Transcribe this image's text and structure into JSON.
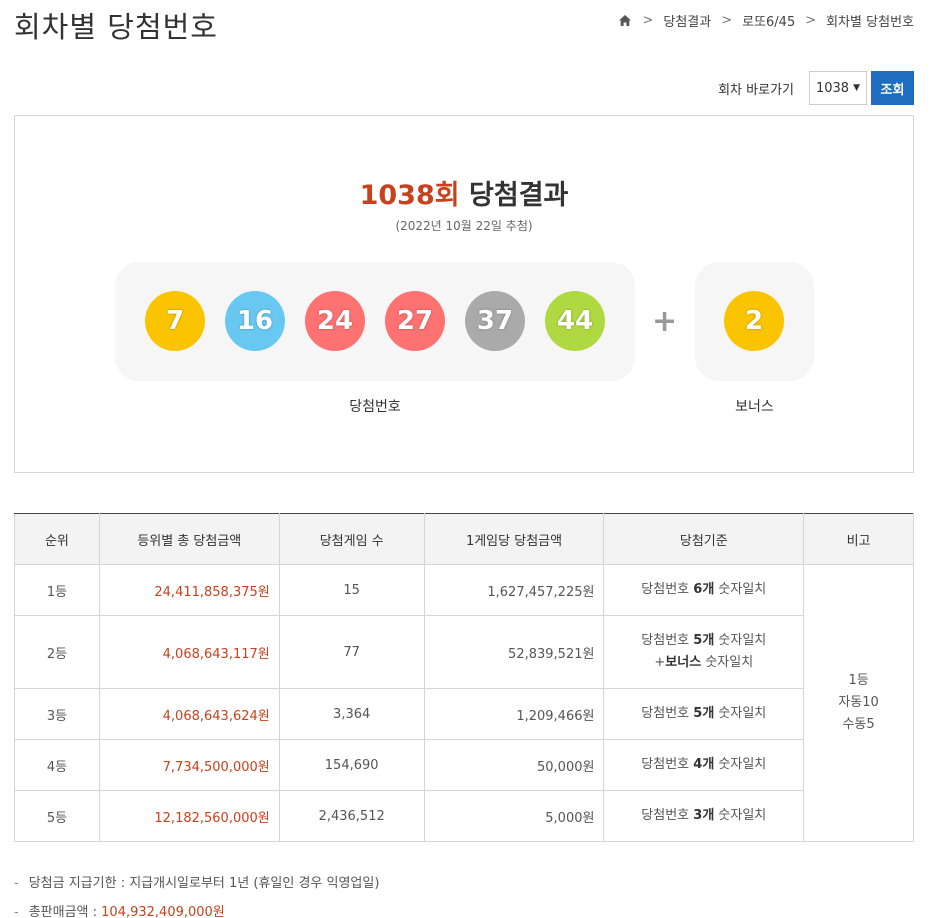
{
  "page": {
    "title": "회차별 당첨번호"
  },
  "breadcrumb": {
    "items": [
      "당첨결과",
      "로또6/45",
      "회차별 당첨번호"
    ]
  },
  "goto": {
    "label": "회차 바로가기",
    "selected": "1038",
    "button": "조회"
  },
  "result": {
    "round": "1038회",
    "title_suffix": " 당첨결과",
    "date": "(2022년 10월 22일 추첨)",
    "numbers": [
      {
        "value": "7",
        "color": "#fbc400"
      },
      {
        "value": "16",
        "color": "#69c8f2"
      },
      {
        "value": "24",
        "color": "#ff7272"
      },
      {
        "value": "27",
        "color": "#ff7272"
      },
      {
        "value": "37",
        "color": "#aaaaaa"
      },
      {
        "value": "44",
        "color": "#b0d840"
      }
    ],
    "plus": "+",
    "bonus": {
      "value": "2",
      "color": "#fbc400"
    },
    "win_label": "당첨번호",
    "bonus_label": "보너스"
  },
  "table": {
    "headers": [
      "순위",
      "등위별 총 당첨금액",
      "당첨게임 수",
      "1게임당 당첨금액",
      "당첨기준",
      "비고"
    ],
    "rows": [
      {
        "rank": "1등",
        "total": "24,411,858,375원",
        "games": "15",
        "per_game": "1,627,457,225원",
        "crit_a": "당첨번호 ",
        "crit_b": "6개",
        "crit_c": " 숫자일치"
      },
      {
        "rank": "2등",
        "total": "4,068,643,117원",
        "games": "77",
        "per_game": "52,839,521원",
        "crit_a": "당첨번호 ",
        "crit_b": "5개",
        "crit_c": " 숫자일치",
        "crit_d": "+",
        "crit_e": "보너스",
        "crit_f": " 숫자일치"
      },
      {
        "rank": "3등",
        "total": "4,068,643,624원",
        "games": "3,364",
        "per_game": "1,209,466원",
        "crit_a": "당첨번호 ",
        "crit_b": "5개",
        "crit_c": " 숫자일치"
      },
      {
        "rank": "4등",
        "total": "7,734,500,000원",
        "games": "154,690",
        "per_game": "50,000원",
        "crit_a": "당첨번호 ",
        "crit_b": "4개",
        "crit_c": " 숫자일치"
      },
      {
        "rank": "5등",
        "total": "12,182,560,000원",
        "games": "2,436,512",
        "per_game": "5,000원",
        "crit_a": "당첨번호 ",
        "crit_b": "3개",
        "crit_c": " 숫자일치"
      }
    ],
    "note": {
      "line1": "1등",
      "line2": "자동10",
      "line3": "수동5"
    }
  },
  "notes": {
    "deadline": "당첨금 지급기한 : 지급개시일로부터 1년 (휴일인 경우 익영업일)",
    "total_label": "총판매금액 : ",
    "total_value": "104,932,409,000원"
  },
  "colors": {
    "accent": "#1e6dc0",
    "highlight": "#c8411d"
  }
}
